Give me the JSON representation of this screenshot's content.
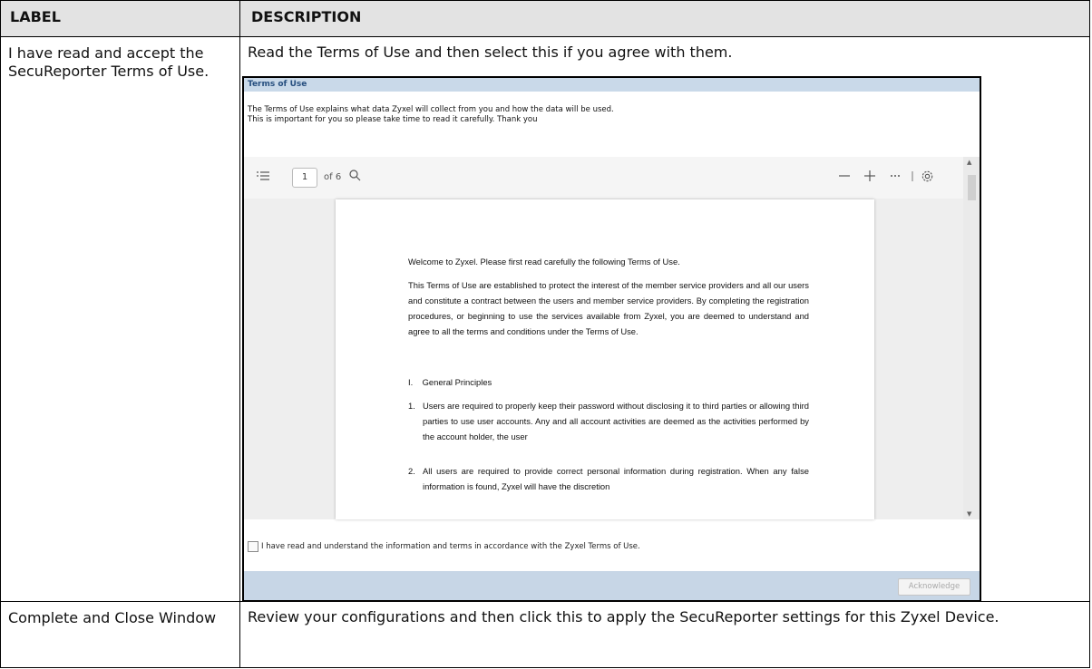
{
  "header": {
    "label": "LABEL",
    "description": "DESCRIPTION"
  },
  "rows": [
    {
      "label": "I have read and accept the SecuReporter Terms of Use.",
      "description": "Read the Terms of Use and then select this if you agree with them."
    },
    {
      "label": "Complete and Close Window",
      "description": "Review your configurations and then click this to apply the SecuReporter settings for this Zyxel Device."
    }
  ],
  "dialog": {
    "title": "Terms of Use",
    "intro_line1": "The Terms of Use explains what data Zyxel will collect from you and how the data will be used.",
    "intro_line2": "This is important for you so please take time to read it carefully. Thank you",
    "viewer": {
      "page_current": "1",
      "page_total": "of 6",
      "icons": [
        "outline-icon",
        "search-icon",
        "zoom-out-icon",
        "zoom-in-icon",
        "more-icon",
        "settings-icon"
      ]
    },
    "document": {
      "welcome": "Welcome to Zyxel. Please first read carefully the following Terms of Use.",
      "paragraph": "This Terms of Use are established to protect the interest of the member service providers and all our users and constitute a contract between the users and member service providers. By completing the registration procedures, or beginning to use the services available from Zyxel, you are deemed to understand and agree to all the terms and conditions under the Terms of Use.",
      "section_num": "I.",
      "section_title": "General Principles",
      "item1_num": "1.",
      "item1": "Users are required to properly keep their password without disclosing it to third parties or allowing third parties to use user accounts. Any and all account activities are deemed as the activities performed by the account holder, the user",
      "item2_num": "2.",
      "item2": "All users are required to provide correct personal information during registration. When any false information is found, Zyxel will have the discretion"
    },
    "checkbox_label": "I have read and understand the information and terms in accordance with the Zyxel Terms of Use.",
    "acknowledge_label": "Acknowledge"
  }
}
